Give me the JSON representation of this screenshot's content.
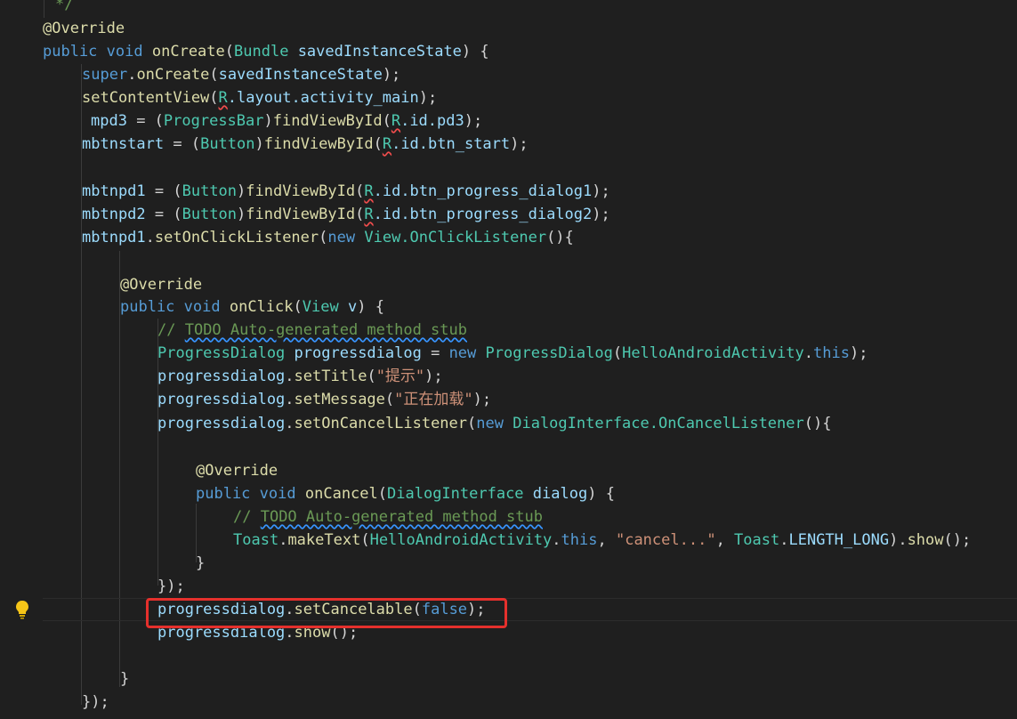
{
  "editor": {
    "annotation": "@Override",
    "lines": {
      "l0": "*/",
      "l1_public": "public",
      "l1_void": "void",
      "l1_fn": "onCreate",
      "l1_type": "Bundle",
      "l1_param": "savedInstanceState",
      "l2_super": "super",
      "l2_fn": "onCreate",
      "l2_arg": "savedInstanceState",
      "l3_fn": "setContentView",
      "l3_r": "R",
      "l3_rest": ".layout.activity_main",
      "l4_var": "mpd3",
      "l4_type": "ProgressBar",
      "l4_fn": "findViewById",
      "l4_r": "R",
      "l4_rest": ".id.pd3",
      "l5_var": "mbtnstart",
      "l5_type": "Button",
      "l5_fn": "findViewById",
      "l5_r": "R",
      "l5_rest": ".id.btn_start",
      "l6_var": "mbtnpd1",
      "l6_rest": ".id.btn_progress_dialog1",
      "l7_var": "mbtnpd2",
      "l7_rest": ".id.btn_progress_dialog2",
      "l8_var": "mbtnpd1",
      "l8_fn": "setOnClickListener",
      "l8_new": "new",
      "l8_type": "View.OnClickListener",
      "l9_fn": "onClick",
      "l9_type": "View",
      "l9_param": "v",
      "todo": "TODO Auto-generated method stub",
      "l10_type": "ProgressDialog",
      "l10_var": "progressdialog",
      "l10_ctor": "ProgressDialog",
      "l10_arg": "HelloAndroidActivity",
      "l10_this": "this",
      "l11_fn": "setTitle",
      "l11_str": "\"提示\"",
      "l12_fn": "setMessage",
      "l12_str": "\"正在加载\"",
      "l13_fn": "setOnCancelListener",
      "l13_type": "DialogInterface.OnCancelListener",
      "l14_fn": "onCancel",
      "l14_type": "DialogInterface",
      "l14_param": "dialog",
      "l15_toast": "Toast",
      "l15_fn": "makeText",
      "l15_arg": "HelloAndroidActivity",
      "l15_str": "\"cancel...\"",
      "l15_const": "LENGTH_LONG",
      "l15_show": "show",
      "l16_fn": "setCancelable",
      "l16_false": "false",
      "l17_fn": "show"
    }
  },
  "icons": {
    "lightbulb": "lightbulb-icon"
  },
  "highlight_color": "#e5302c"
}
